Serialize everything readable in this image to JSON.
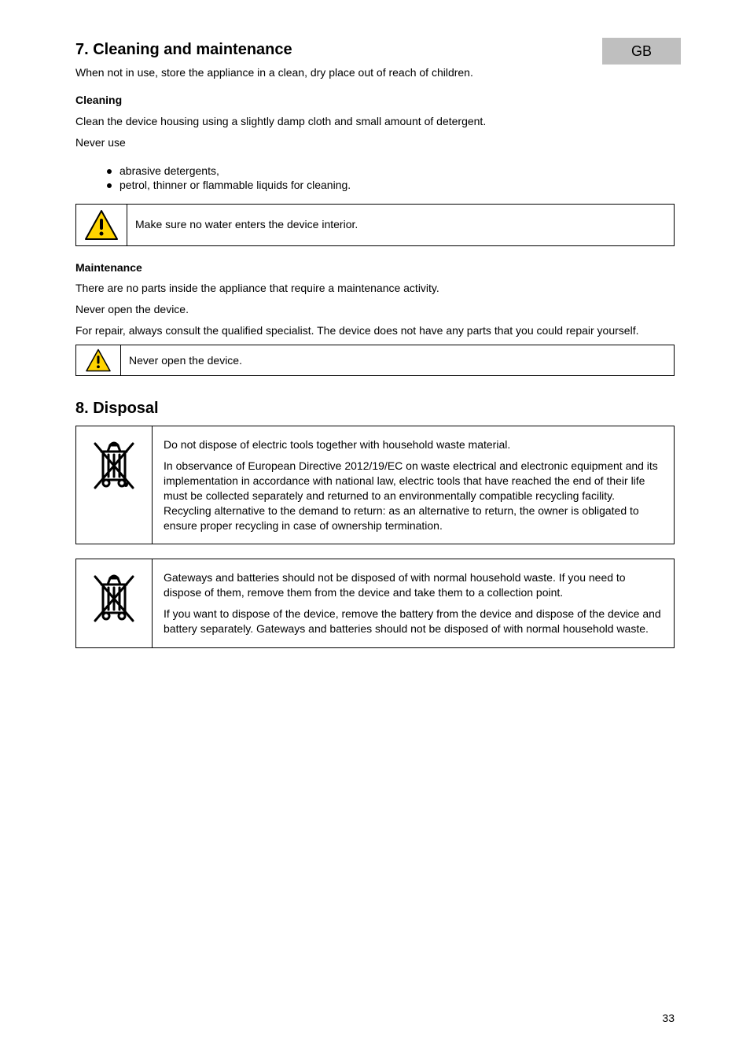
{
  "tab": {
    "lang": "GB"
  },
  "page": {
    "num": "33"
  },
  "s7": {
    "heading": "7. Cleaning and maintenance",
    "intro": "When not in use, store the appliance in a clean, dry place out of reach of children.",
    "sub1": "Cleaning",
    "p1": "Clean the device housing using a slightly damp cloth and small amount of detergent.",
    "p2": "Never use",
    "bullets": [
      "abrasive detergents,",
      "petrol, thinner or flammable liquids for cleaning."
    ],
    "warn1": "Make sure no water enters the device interior.",
    "sub2": "Maintenance",
    "p3": "There are no parts inside the appliance that require a maintenance activity.",
    "p4": "Never open the device.",
    "p5": "For repair, always consult the qualified specialist. The device does not have any parts that you could repair yourself.",
    "warn2": "Never open the device."
  },
  "s8": {
    "heading": "8. Disposal",
    "box1a": "Do not dispose of electric tools together with household waste material.",
    "box1b": "In observance of European Directive 2012/19/EC on waste electrical and electronic equipment and its implementation in accordance with national law, electric tools that have reached the end of their life must be collected separately and returned to an environmentally compatible recycling facility. Recycling alternative to the demand to return: as an alternative to return, the owner is obligated to ensure proper recycling in case of ownership termination.",
    "box2a": "Gateways and batteries should not be disposed of with normal household waste. If you need to dispose of them, remove them from the device and take them to a collection point.",
    "box2b": "If you want to dispose of the device, remove the battery from the device and dispose of the device and battery separately. Gateways and batteries should not be disposed of with normal household waste."
  }
}
